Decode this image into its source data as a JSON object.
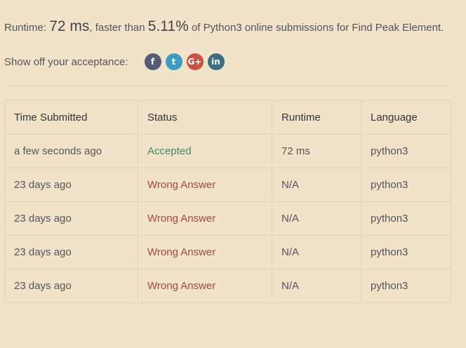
{
  "result": {
    "runtime_prefix": "Runtime: ",
    "runtime_value": "72 ms",
    "faster_than": ", faster than ",
    "percent": "5.11%",
    "suffix": " of Python3 online submissions for Find Peak Element."
  },
  "share": {
    "label": "Show off your acceptance:",
    "icons": [
      {
        "name": "facebook-icon",
        "glyph": "f",
        "color": "#555c75"
      },
      {
        "name": "twitter-icon",
        "glyph": "t",
        "color": "#3d9bc4"
      },
      {
        "name": "google-plus-icon",
        "glyph": "G+",
        "color": "#c9513f"
      },
      {
        "name": "linkedin-icon",
        "glyph": "in",
        "color": "#3d6d7e"
      }
    ]
  },
  "table": {
    "headers": [
      "Time Submitted",
      "Status",
      "Runtime",
      "Language"
    ],
    "rows": [
      {
        "time": "a few seconds ago",
        "status": "Accepted",
        "status_type": "accepted",
        "runtime": "72 ms",
        "language": "python3"
      },
      {
        "time": "23 days ago",
        "status": "Wrong Answer",
        "status_type": "wrong",
        "runtime": "N/A",
        "language": "python3"
      },
      {
        "time": "23 days ago",
        "status": "Wrong Answer",
        "status_type": "wrong",
        "runtime": "N/A",
        "language": "python3"
      },
      {
        "time": "23 days ago",
        "status": "Wrong Answer",
        "status_type": "wrong",
        "runtime": "N/A",
        "language": "python3"
      },
      {
        "time": "23 days ago",
        "status": "Wrong Answer",
        "status_type": "wrong",
        "runtime": "N/A",
        "language": "python3"
      }
    ]
  },
  "colors": {
    "background": "#f1e3ca",
    "accepted": "#3d8a66",
    "wrong": "#a5473e"
  }
}
